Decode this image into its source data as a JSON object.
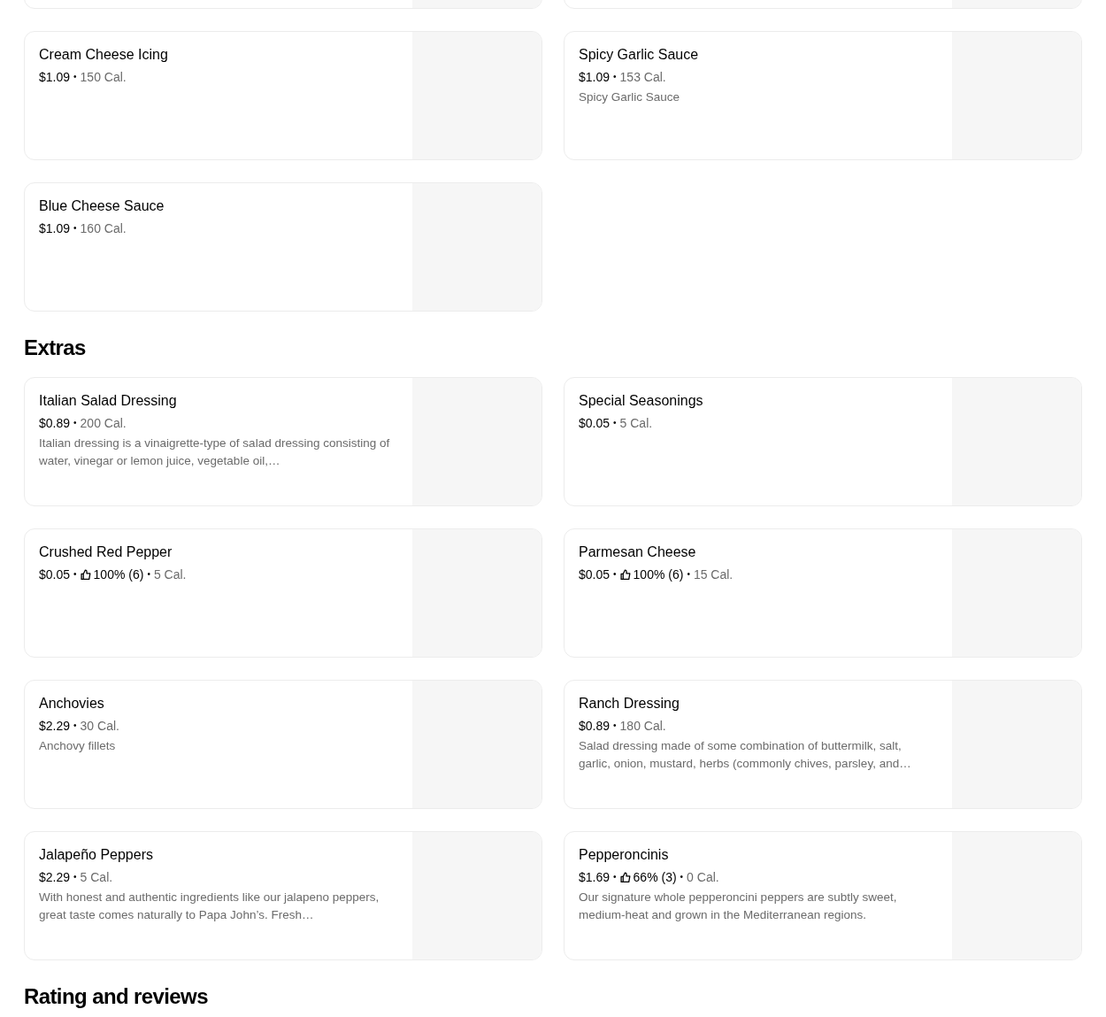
{
  "sections": [
    {
      "items": [
        {
          "kind": "cut_off"
        },
        {
          "kind": "cut_off"
        },
        {
          "kind": "item",
          "name": "Cream Cheese Icing",
          "meta": [
            {
              "kind": "price",
              "text": "$1.09"
            },
            {
              "kind": "separator",
              "text": "•"
            },
            {
              "kind": "calories",
              "text": "150 Cal."
            }
          ]
        },
        {
          "kind": "item",
          "name": "Spicy Garlic Sauce",
          "meta": [
            {
              "kind": "price",
              "text": "$1.09"
            },
            {
              "kind": "separator",
              "text": "•"
            },
            {
              "kind": "calories",
              "text": "153 Cal."
            }
          ],
          "description": "Spicy Garlic Sauce"
        },
        {
          "kind": "item",
          "name": "Blue Cheese Sauce",
          "meta": [
            {
              "kind": "price",
              "text": "$1.09"
            },
            {
              "kind": "separator",
              "text": "•"
            },
            {
              "kind": "calories",
              "text": "160 Cal."
            }
          ]
        }
      ]
    },
    {
      "title": "Extras",
      "items": [
        {
          "kind": "item",
          "name": "Italian Salad Dressing",
          "meta": [
            {
              "kind": "price",
              "text": "$0.89"
            },
            {
              "kind": "separator",
              "text": "•"
            },
            {
              "kind": "calories",
              "text": "200 Cal."
            }
          ],
          "description": "Italian dressing is a vinaigrette-type of salad dressing consisting of water, vinegar or lemon juice, vegetable oil,…"
        },
        {
          "kind": "item",
          "name": "Special Seasonings",
          "meta": [
            {
              "kind": "price",
              "text": "$0.05"
            },
            {
              "kind": "separator",
              "text": "•"
            },
            {
              "kind": "calories",
              "text": "5 Cal."
            }
          ]
        },
        {
          "kind": "item",
          "name": "Crushed Red Pepper",
          "meta": [
            {
              "kind": "price",
              "text": "$0.05"
            },
            {
              "kind": "separator",
              "text": "•"
            },
            {
              "kind": "rating",
              "text": "100% (6)"
            },
            {
              "kind": "separator",
              "text": "•"
            },
            {
              "kind": "calories",
              "text": "5 Cal."
            }
          ]
        },
        {
          "kind": "item",
          "name": "Parmesan Cheese",
          "meta": [
            {
              "kind": "price",
              "text": "$0.05"
            },
            {
              "kind": "separator",
              "text": "•"
            },
            {
              "kind": "rating",
              "text": "100% (6)"
            },
            {
              "kind": "separator",
              "text": "•"
            },
            {
              "kind": "calories",
              "text": "15 Cal."
            }
          ]
        },
        {
          "kind": "item",
          "name": "Anchovies",
          "meta": [
            {
              "kind": "price",
              "text": "$2.29"
            },
            {
              "kind": "separator",
              "text": "•"
            },
            {
              "kind": "calories",
              "text": "30 Cal."
            }
          ],
          "description": "Anchovy fillets"
        },
        {
          "kind": "item",
          "name": "Ranch Dressing",
          "meta": [
            {
              "kind": "price",
              "text": "$0.89"
            },
            {
              "kind": "separator",
              "text": "•"
            },
            {
              "kind": "calories",
              "text": "180 Cal."
            }
          ],
          "description": "Salad dressing made of some combination of buttermilk, salt, garlic, onion, mustard, herbs (commonly chives, parsley, and…"
        },
        {
          "kind": "item",
          "name": "Jalapeño Peppers",
          "meta": [
            {
              "kind": "price",
              "text": "$2.29"
            },
            {
              "kind": "separator",
              "text": "•"
            },
            {
              "kind": "calories",
              "text": "5 Cal."
            }
          ],
          "description": "With honest and authentic ingredients like our jalapeno peppers, great taste comes naturally to Papa John’s. Fresh…"
        },
        {
          "kind": "item",
          "name": "Pepperoncinis",
          "meta": [
            {
              "kind": "price",
              "text": "$1.69"
            },
            {
              "kind": "separator",
              "text": "•"
            },
            {
              "kind": "rating",
              "text": "66% (3)"
            },
            {
              "kind": "separator",
              "text": "•"
            },
            {
              "kind": "calories",
              "text": "0 Cal."
            }
          ],
          "description": "Our signature whole pepperoncini peppers are subtly sweet, medium-heat and grown in the Mediterranean regions."
        }
      ]
    },
    {
      "title": "Rating and reviews"
    }
  ]
}
